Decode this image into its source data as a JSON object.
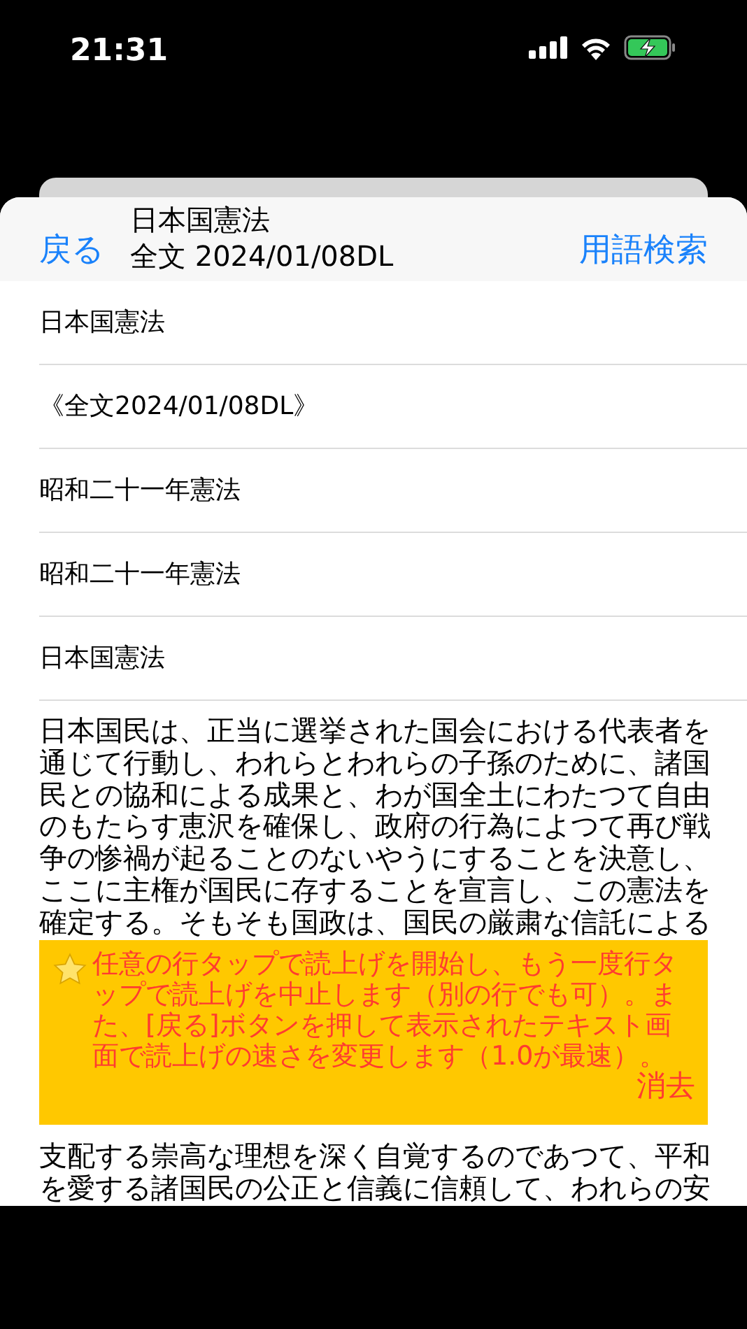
{
  "status_bar": {
    "time": "21:31"
  },
  "nav": {
    "back": "戻る",
    "title": [
      "日本国憲法",
      "全文 2024/01/08DL"
    ],
    "action": "用語検索"
  },
  "rows": [
    "日本国憲法",
    "《全文2024/01/08DL》",
    "昭和二十一年憲法",
    "昭和二十一年憲法",
    "日本国憲法"
  ],
  "paragraph_1": "日本国民は、正当に選挙された国会における代表者を通じて行動し、われらとわれらの子孫のために、諸国民との協和による成果と、わが国全土にわたつて自由のもたらす恵沢を確保し、政府の行為によつて再び戦争の惨禍が起ることのないやうにすることを決意し、ここに主権が国民に存することを宣言し、この憲法を確定する。そもそも国政は、国民の厳粛な信託による",
  "notice": {
    "message": "任意の行タップで読上げを開始し、もう一度行タップで読上げを中止します（別の行でも可）。また、[戻る]ボタンを押して表示されたテキスト画面で読上げの速さを変更します（1.0が最速）。",
    "dismiss": "消去"
  },
  "paragraph_2": "支配する崇高な理想を深く自覚するのであつて、平和を愛する諸国民の公正と信義に信頼して、われらの安"
}
